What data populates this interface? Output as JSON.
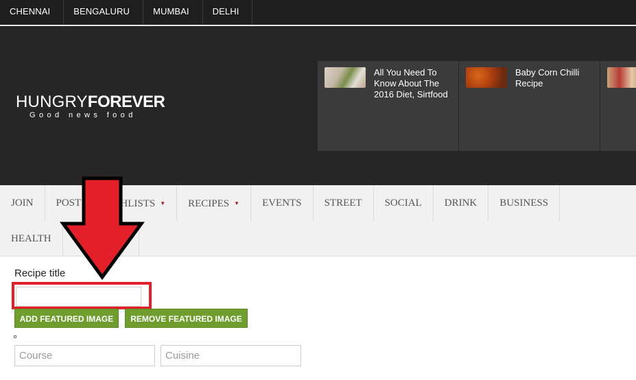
{
  "cities": [
    "CHENNAI",
    "BENGALURU",
    "MUMBAI",
    "DELHI"
  ],
  "logo": {
    "main_light": "HUNGRY",
    "main_bold": "FOREVER",
    "tagline": "Good news food"
  },
  "featured": [
    {
      "title": "All You Need To Know About The 2016 Diet, Sirtfood",
      "thumb": "salad-plate-image"
    },
    {
      "title": "Baby Corn Chilli Recipe",
      "thumb": "baby-corn-chilli-image"
    },
    {
      "title": "",
      "thumb": "people-photo-image"
    }
  ],
  "nav": {
    "row1": [
      {
        "label": "JOIN",
        "caret": false
      },
      {
        "label": "POST",
        "caret": false
      },
      {
        "label": "DISHLISTS",
        "caret": true
      },
      {
        "label": "RECIPES",
        "caret": true
      },
      {
        "label": "EVENTS",
        "caret": false
      },
      {
        "label": "STREET",
        "caret": false
      },
      {
        "label": "SOCIAL",
        "caret": false
      },
      {
        "label": "DRINK",
        "caret": false
      },
      {
        "label": "BUSINESS",
        "caret": false
      }
    ],
    "row2": [
      {
        "label": "HEALTH",
        "caret": false
      },
      {
        "label": "",
        "caret": false
      }
    ],
    "caret_symbol": "▼"
  },
  "form": {
    "recipe_title_label": "Recipe title",
    "recipe_title_value": "",
    "add_featured_image": "ADD FEATURED IMAGE",
    "remove_featured_image": "REMOVE FEATURED IMAGE",
    "course_placeholder": "Course",
    "cuisine_placeholder": "Cuisine"
  },
  "colors": {
    "top_bar": "#1e1e1e",
    "header": "#262626",
    "featured_card": "#3b3b3b",
    "nav_bg": "#f1f1f1",
    "button_green": "#6f9e2f",
    "highlight_red": "#e3202a"
  }
}
